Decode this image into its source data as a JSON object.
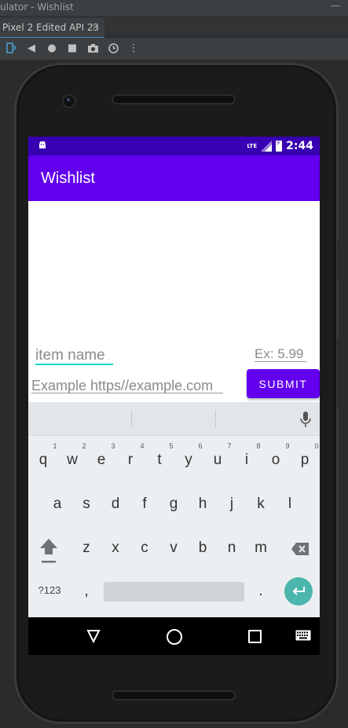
{
  "window": {
    "title": "ulator - Wishlist"
  },
  "tab": {
    "label": "Pixel 2 Edited API 23",
    "close": "×"
  },
  "status": {
    "time": "2:44",
    "network": "LTE"
  },
  "app": {
    "title": "Wishlist"
  },
  "form": {
    "name_placeholder": "item name",
    "price_placeholder": "Ex: 5.99",
    "url_placeholder": "Example https//example.com",
    "submit_label": "SUBMIT"
  },
  "keyboard": {
    "row1": [
      "q",
      "w",
      "e",
      "r",
      "t",
      "y",
      "u",
      "i",
      "o",
      "p"
    ],
    "row1_hints": [
      "1",
      "2",
      "3",
      "4",
      "5",
      "6",
      "7",
      "8",
      "9",
      "0"
    ],
    "row2": [
      "a",
      "s",
      "d",
      "f",
      "g",
      "h",
      "j",
      "k",
      "l"
    ],
    "row3": [
      "z",
      "x",
      "c",
      "v",
      "b",
      "n",
      "m"
    ],
    "symbols_label": "?123",
    "comma": ",",
    "period": "."
  },
  "colors": {
    "primary": "#6200ee",
    "primary_dark": "#3700b3",
    "accent": "#03dac5"
  }
}
